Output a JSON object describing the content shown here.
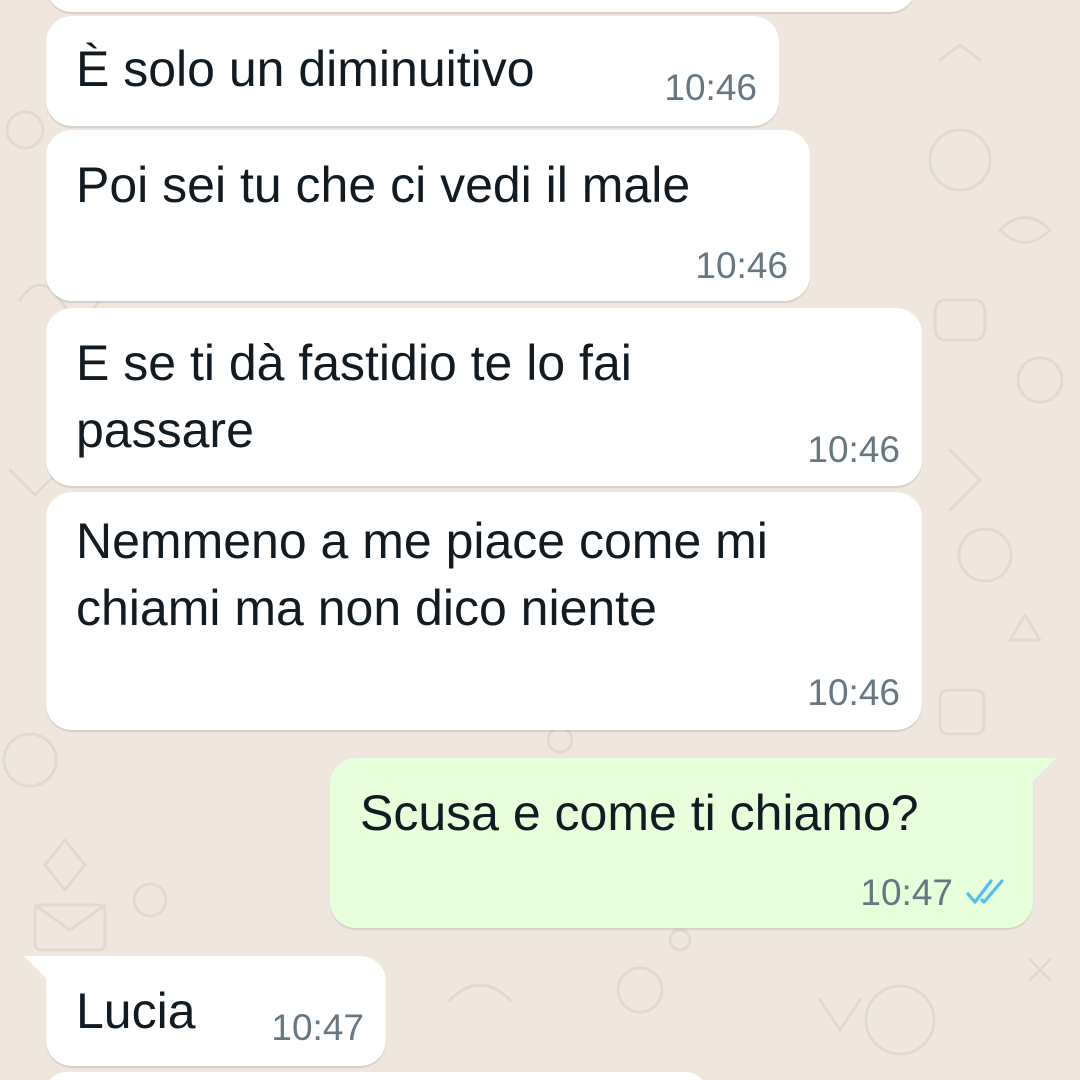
{
  "colors": {
    "chat_background": "#efe7dd",
    "incoming_bubble": "#ffffff",
    "outgoing_bubble": "#e7ffdb",
    "timestamp_text": "#667781",
    "read_ticks": "#53bdeb"
  },
  "messages": [
    {
      "direction": "incoming",
      "text": "È solo un diminuitivo",
      "time": "10:46"
    },
    {
      "direction": "incoming",
      "text": "Poi sei tu che ci vedi il male",
      "time": "10:46"
    },
    {
      "direction": "incoming",
      "lines": [
        "E se ti dà fastidio te lo fai",
        "passare"
      ],
      "time": "10:46"
    },
    {
      "direction": "incoming",
      "lines": [
        "Nemmeno a me piace come mi",
        "chiami ma non dico niente"
      ],
      "time": "10:46"
    },
    {
      "direction": "outgoing",
      "text": "Scusa e come ti chiamo?",
      "time": "10:47",
      "status_icon": "double-check-read-icon"
    },
    {
      "direction": "incoming",
      "text": "Lucia",
      "time": "10:47"
    }
  ]
}
